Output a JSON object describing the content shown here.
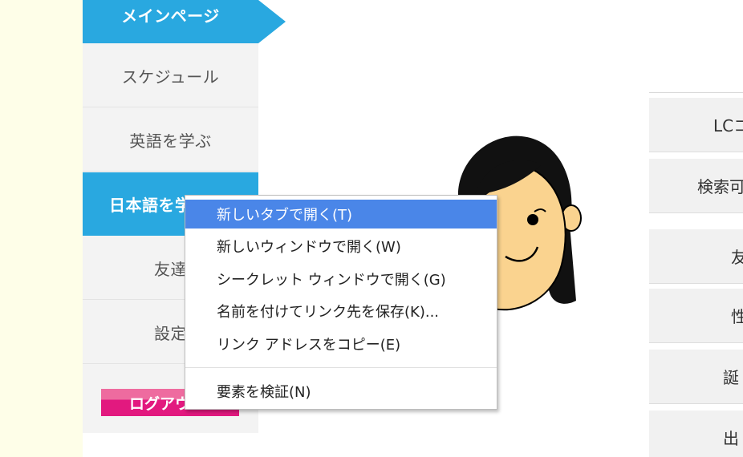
{
  "sidebar": {
    "main_label": "メインページ",
    "items": [
      {
        "label": "スケジュール"
      },
      {
        "label": "英語を学ぶ"
      },
      {
        "label": "日本語を学"
      },
      {
        "label": "友達"
      },
      {
        "label": "設定"
      }
    ],
    "logout_label": "ログアウ"
  },
  "right_panel": {
    "items": [
      {
        "label": "LCコ"
      },
      {
        "label": "検索可"
      },
      {
        "label": "友"
      },
      {
        "label": "性"
      },
      {
        "label": "誕"
      },
      {
        "label": "出"
      }
    ]
  },
  "context_menu": {
    "items": [
      {
        "label": "新しいタブで開く(T)"
      },
      {
        "label": "新しいウィンドウで開く(W)"
      },
      {
        "label": "シークレット ウィンドウで開く(G)"
      },
      {
        "label": "名前を付けてリンク先を保存(K)..."
      },
      {
        "label": "リンク アドレスをコピー(E)"
      },
      {
        "label": "要素を検証(N)"
      }
    ]
  },
  "colors": {
    "accent": "#29a8e0",
    "logout": "#e2197f",
    "menu_highlight": "#4a86e8",
    "page_background": "#fefee8"
  },
  "avatar": {
    "icon": "girl-avatar-icon"
  }
}
